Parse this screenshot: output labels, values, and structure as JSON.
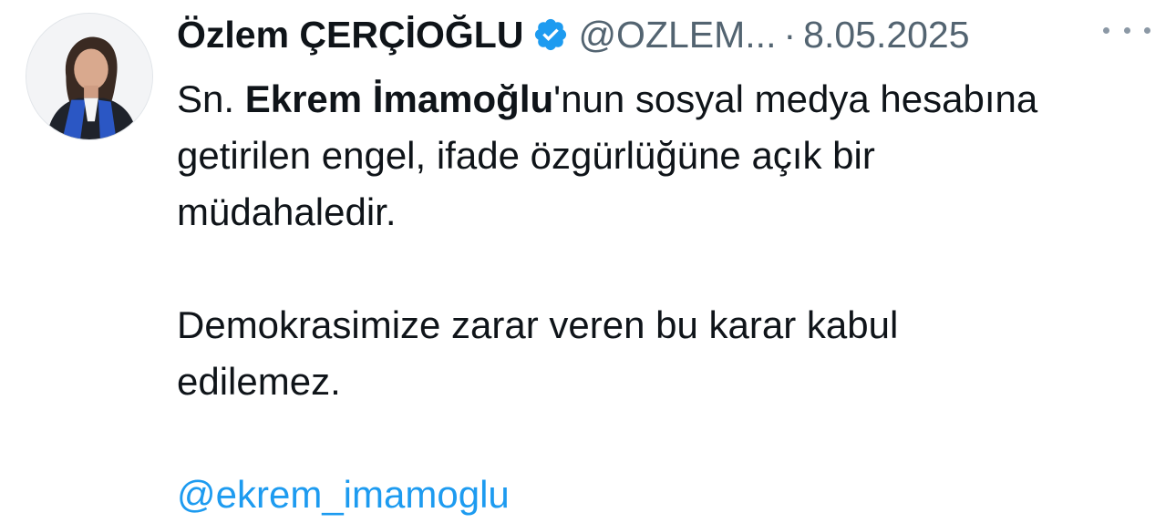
{
  "tweet": {
    "author_name": "Özlem ÇERÇİOĞLU",
    "handle": "@OZLEM...",
    "separator": "·",
    "date": "8.05.2025",
    "body": {
      "line1_prefix": "Sn. ",
      "line1_bold": "Ekrem İmamoğlu",
      "line1_suffix": "'nun sosyal medya hesabına",
      "line2": "getirilen engel, ifade özgürlüğüne açık bir",
      "line3": "müdahaledir.",
      "line4": "Demokrasimize zarar veren bu karar kabul",
      "line5": "edilemez.",
      "mention": "@ekrem_imamoglu"
    },
    "icons": {
      "verified": "verified-badge-icon",
      "more": "more-options-icon"
    },
    "colors": {
      "verified": "#1d9bf0",
      "mention": "#1d9bf0",
      "secondary_text": "#536471"
    }
  }
}
